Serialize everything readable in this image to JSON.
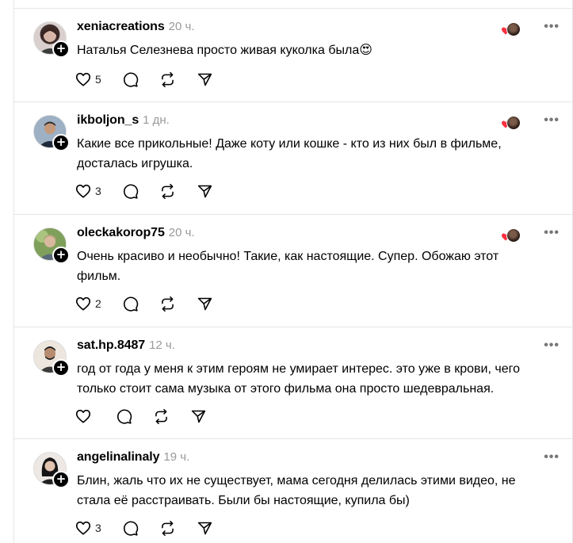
{
  "colors": {
    "heart": "#ff3040",
    "badge": "#000000",
    "time": "#999999"
  },
  "posts": [
    {
      "username": "xeniacreations",
      "time": "20 ч.",
      "text": "Наталья Селезнева просто живая куколка была😍",
      "likes": "5",
      "has_reaction": true
    },
    {
      "username": "ikboljon_s",
      "time": "1 дн.",
      "text": "Какие все прикольные! Даже коту или кошке - кто из них был в фильме, досталась игрушка.",
      "likes": "3",
      "has_reaction": true
    },
    {
      "username": "oleckakorop75",
      "time": "20 ч.",
      "text": "Очень красиво и необычно! Такие, как настоящие. Супер. Обожаю этот фильм.",
      "likes": "2",
      "has_reaction": true
    },
    {
      "username": "sat.hp.8487",
      "time": "12 ч.",
      "text": "год от года у меня к этим героям не умирает интерес. это уже в крови, чего только стоит сама музыка от этого фильма она просто шедевральная.",
      "likes": "",
      "has_reaction": false
    },
    {
      "username": "angelinalinaly",
      "time": "19 ч.",
      "text": "Блин, жаль что их не существует, мама сегодня делилась этими видео, не стала её расстраивать. Были бы настоящие, купила бы)",
      "likes": "3",
      "has_reaction": false
    }
  ],
  "icons": {
    "like": "heart-outline-icon",
    "comment": "comment-bubble-icon",
    "repost": "repost-arrows-icon",
    "share": "paper-plane-icon",
    "more": "more-horizontal-icon",
    "follow": "plus-badge-icon"
  },
  "more_label": "•••",
  "follow_label": "+"
}
